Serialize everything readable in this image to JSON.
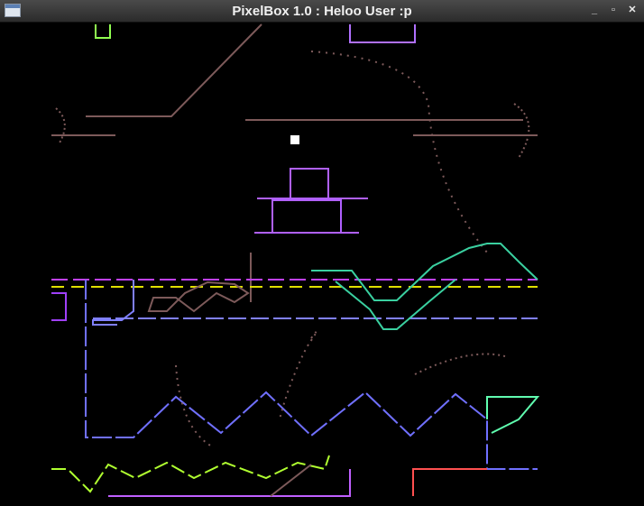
{
  "window": {
    "title": "PixelBox 1.0 : Heloo User :p",
    "controls": {
      "minimize_icon": "minimize-icon",
      "maximize_icon": "maximize-icon",
      "close_icon": "close-icon",
      "minimize_glyph": "_",
      "maximize_glyph": "▫",
      "close_glyph": "✕"
    }
  },
  "canvas": {
    "background": "#000000",
    "accent_colors": {
      "particle_brown": "#7d5a5a",
      "cake_purple": "#b060ff",
      "wave_teal": "#3ad0a0",
      "cursor_white": "#ffffff"
    }
  }
}
